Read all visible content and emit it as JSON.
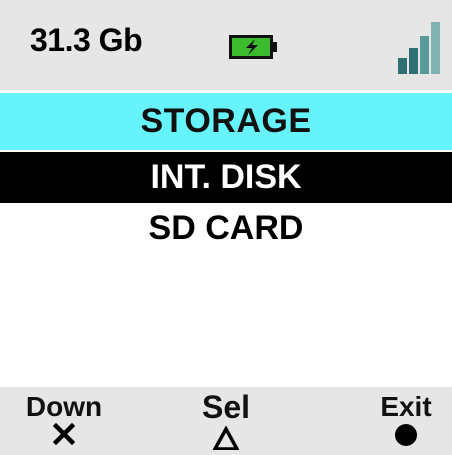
{
  "status_bar": {
    "storage_free": "31.3 Gb",
    "battery_icon": "battery-charging-icon",
    "battery_color": "#3dbb2e",
    "signal_icon": "signal-strength-icon",
    "signal_color": "#2f6f73"
  },
  "screen": {
    "title": "STORAGE",
    "title_band_color": "#66f3fb"
  },
  "menu": {
    "items": [
      {
        "label": "INT. DISK",
        "selected": true
      },
      {
        "label": "SD CARD",
        "selected": false
      }
    ]
  },
  "softkeys": {
    "down": {
      "label": "Down",
      "icon": "cross-icon"
    },
    "select": {
      "label": "Sel",
      "icon": "triangle-icon"
    },
    "exit": {
      "label": "Exit",
      "icon": "circle-icon"
    }
  }
}
